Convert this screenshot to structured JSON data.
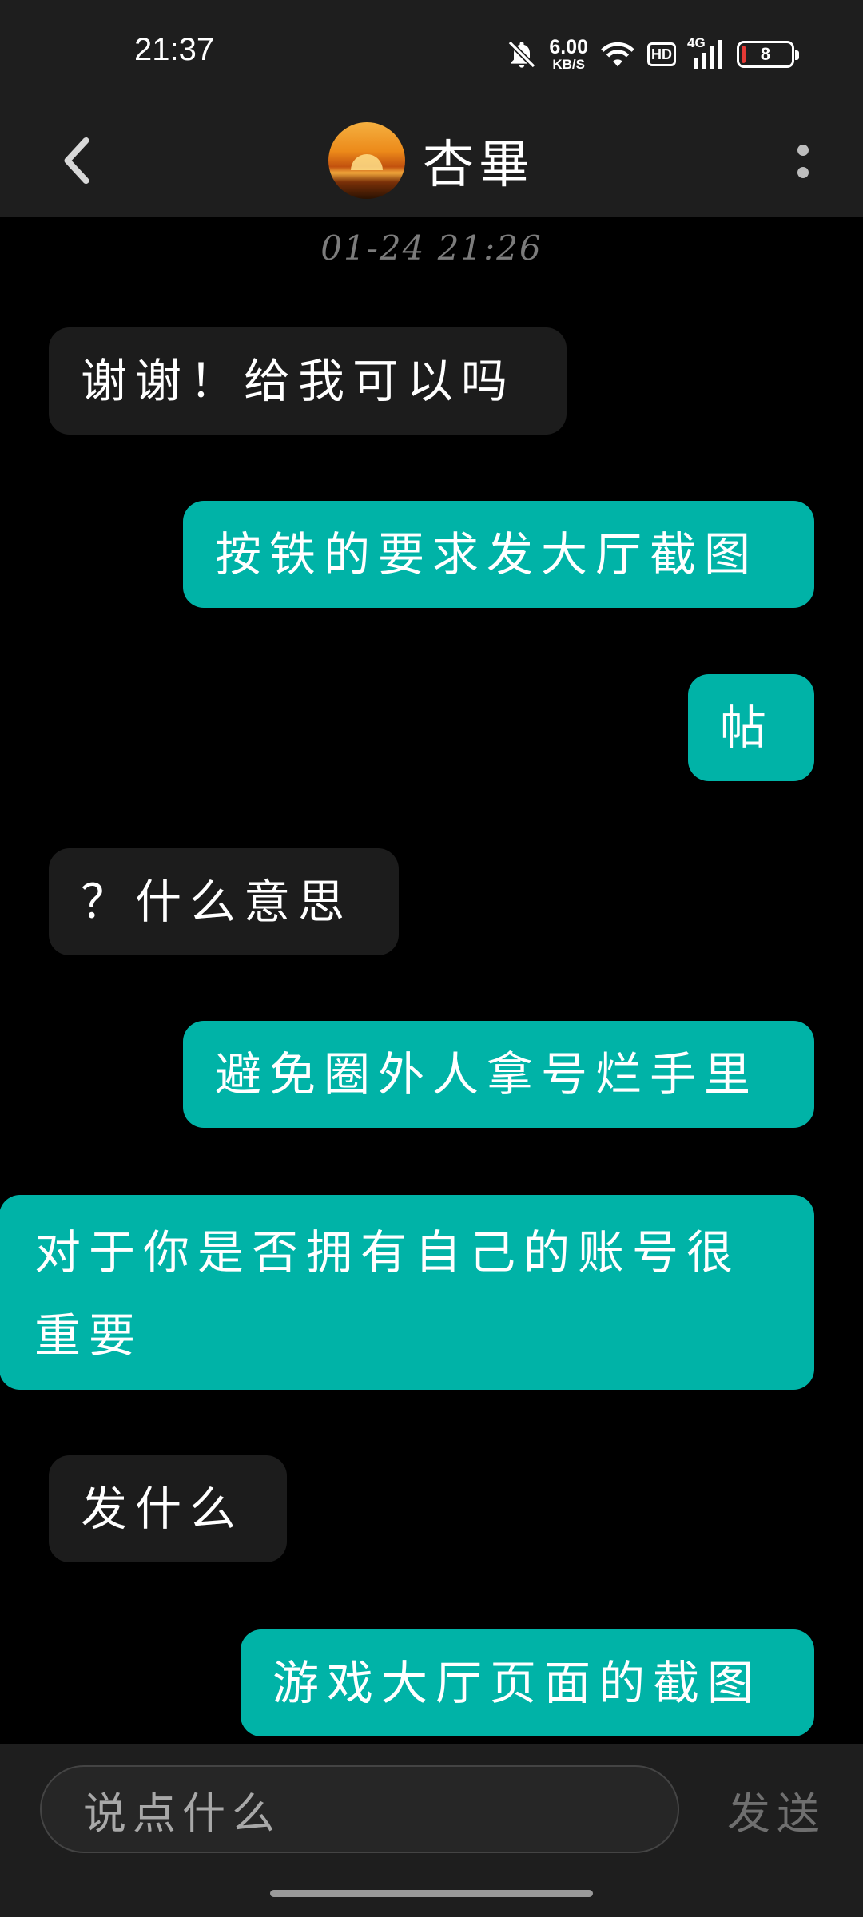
{
  "status_bar": {
    "time": "21:37",
    "net_speed_value": "6.00",
    "net_speed_unit": "KB/S",
    "hd_label": "HD",
    "network_label": "4G",
    "battery": "8",
    "icons": [
      "mute-bell-icon",
      "wifi-icon",
      "signal-icon",
      "battery-icon"
    ]
  },
  "header": {
    "contact_name": "杏畢",
    "icons": [
      "back-arrow-icon",
      "avatar",
      "more-vertical-icon"
    ]
  },
  "chat": {
    "timestamp": "01-24 21:26",
    "messages": [
      {
        "direction": "incoming",
        "text": "谢谢！给我可以吗"
      },
      {
        "direction": "outgoing",
        "text": "按铁的要求发大厅截图"
      },
      {
        "direction": "outgoing",
        "text": "帖"
      },
      {
        "direction": "incoming",
        "text": "？什么意思"
      },
      {
        "direction": "outgoing",
        "text": "避免圈外人拿号烂手里"
      },
      {
        "direction": "outgoing",
        "text": "对于你是否拥有自己的账号很重要"
      },
      {
        "direction": "incoming",
        "text": "发什么"
      },
      {
        "direction": "outgoing",
        "text": "游戏大厅页面的截图"
      }
    ]
  },
  "input_bar": {
    "placeholder": "说点什么",
    "send_label": "发送"
  },
  "colors": {
    "background": "#000000",
    "bar": "#1e1e1e",
    "incoming_bubble": "#1c1c1c",
    "outgoing_bubble": "#00b3a7",
    "timestamp": "#7c7c7c"
  }
}
